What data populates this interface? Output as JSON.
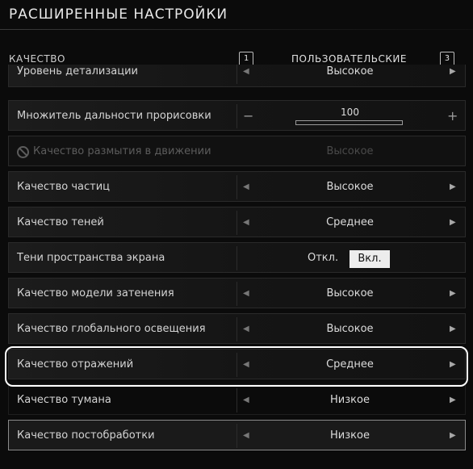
{
  "header": {
    "title": "РАСШИРЕННЫЕ НАСТРОЙКИ"
  },
  "quality": {
    "label": "КАЧЕСТВО",
    "key_prev": "1",
    "key_next": "3",
    "preset": "ПОЛЬЗОВАТЕЛЬСКИЕ"
  },
  "rows": {
    "lod": {
      "label": "Уровень детализации",
      "value": "Высокое"
    },
    "draw_distance": {
      "label": "Множитель дальности прорисовки",
      "value": "100",
      "minus": "−",
      "plus": "+"
    },
    "motion_blur": {
      "label": "Качество размытия в движении",
      "value": "Высокое"
    },
    "particles": {
      "label": "Качество частиц",
      "value": "Высокое"
    },
    "shadows": {
      "label": "Качество теней",
      "value": "Среднее"
    },
    "ss_shadows": {
      "label": "Тени пространства экрана",
      "off_label": "Откл.",
      "on_label": "Вкл.",
      "selected": "Вкл."
    },
    "shading": {
      "label": "Качество модели затенения",
      "value": "Высокое"
    },
    "gi": {
      "label": "Качество глобального освещения",
      "value": "Высокое"
    },
    "reflections": {
      "label": "Качество отражений",
      "value": "Среднее"
    },
    "fog": {
      "label": "Качество тумана",
      "value": "Низкое"
    },
    "post": {
      "label": "Качество постобработки",
      "value": "Низкое"
    }
  },
  "arrows": {
    "left": "◀",
    "right": "▶"
  },
  "icons": {
    "disabled_marker": "ban-icon"
  }
}
